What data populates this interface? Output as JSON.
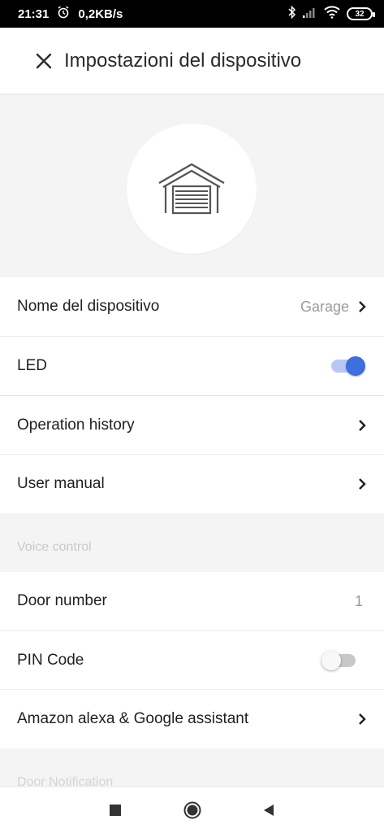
{
  "status_bar": {
    "time": "21:31",
    "speed": "0,2KB/s",
    "battery": "32"
  },
  "header": {
    "title": "Impostazioni del dispositivo"
  },
  "rows": {
    "device_name": {
      "label": "Nome del dispositivo",
      "value": "Garage"
    },
    "led": {
      "label": "LED",
      "enabled": true
    },
    "operation_history": {
      "label": "Operation history"
    },
    "user_manual": {
      "label": "User manual"
    },
    "door_number": {
      "label": "Door number",
      "value": "1"
    },
    "pin_code": {
      "label": "PIN Code",
      "enabled": false
    },
    "assistants": {
      "label": "Amazon alexa & Google assistant"
    }
  },
  "sections": {
    "voice_control": "Voice control",
    "door_notification": "Door Notification"
  },
  "colors": {
    "accent": "#3f6fde",
    "accent_track": "#b8c8f2"
  }
}
